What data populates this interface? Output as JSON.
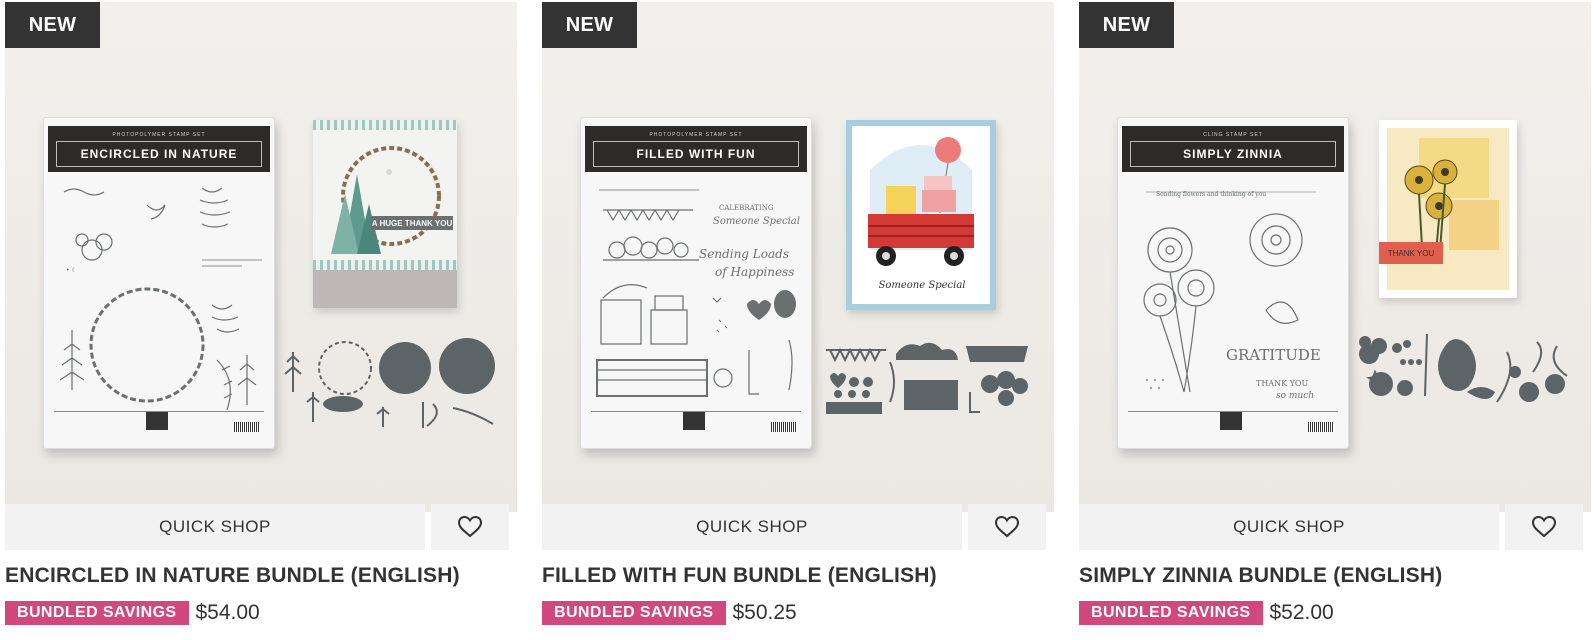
{
  "products": [
    {
      "badge": "NEW",
      "package_small": "PHOTOPOLYMER STAMP SET",
      "package_title": "ENCIRCLED IN NATURE",
      "sample_text": "A HUGE THANK YOU",
      "quick_shop": "QUICK SHOP",
      "title": "ENCIRCLED IN NATURE BUNDLE (ENGLISH)",
      "savings_label": "BUNDLED SAVINGS",
      "price": "$54.00"
    },
    {
      "badge": "NEW",
      "package_small": "PHOTOPOLYMER STAMP SET",
      "package_title": "FILLED WITH FUN",
      "sample_text": "Someone Special",
      "quick_shop": "QUICK SHOP",
      "title": "FILLED WITH FUN BUNDLE (ENGLISH)",
      "savings_label": "BUNDLED SAVINGS",
      "price": "$50.25"
    },
    {
      "badge": "NEW",
      "package_small": "CLING STAMP SET",
      "package_title": "SIMPLY ZINNIA",
      "sample_text": "THANK YOU",
      "quick_shop": "QUICK SHOP",
      "title": "SIMPLY ZINNIA BUNDLE (ENGLISH)",
      "savings_label": "BUNDLED SAVINGS",
      "price": "$52.00"
    }
  ],
  "colors": {
    "badge_bg": "#333333",
    "savings_bg": "#d1487f",
    "button_bg": "#f2f2f2",
    "text": "#333333"
  },
  "icons": {
    "wishlist": "heart-outline-icon"
  }
}
